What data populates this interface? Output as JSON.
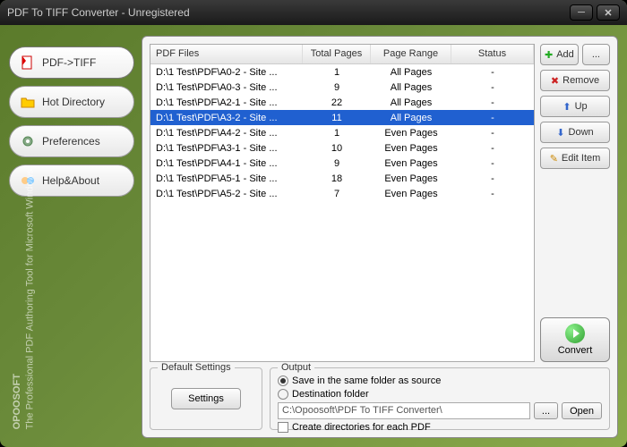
{
  "titlebar": {
    "title": "PDF To TIFF Converter - Unregistered"
  },
  "sidebar": {
    "items": [
      {
        "label": "PDF->TIFF"
      },
      {
        "label": "Hot Directory"
      },
      {
        "label": "Preferences"
      },
      {
        "label": "Help&About"
      }
    ]
  },
  "branding": {
    "name": "OPOOSOFT",
    "tagline": "The Professional PDF Authoring Tool for Microsoft Windows"
  },
  "table": {
    "headers": {
      "file": "PDF Files",
      "pages": "Total Pages",
      "range": "Page Range",
      "status": "Status"
    },
    "rows": [
      {
        "file": "D:\\1 Test\\PDF\\A0-2 - Site ...",
        "pages": "1",
        "range": "All Pages",
        "status": "-"
      },
      {
        "file": "D:\\1 Test\\PDF\\A0-3 - Site ...",
        "pages": "9",
        "range": "All Pages",
        "status": "-"
      },
      {
        "file": "D:\\1 Test\\PDF\\A2-1 - Site ...",
        "pages": "22",
        "range": "All Pages",
        "status": "-"
      },
      {
        "file": "D:\\1 Test\\PDF\\A3-2 - Site ...",
        "pages": "11",
        "range": "All Pages",
        "status": "-"
      },
      {
        "file": "D:\\1 Test\\PDF\\A4-2 - Site ...",
        "pages": "1",
        "range": "Even Pages",
        "status": "-"
      },
      {
        "file": "D:\\1 Test\\PDF\\A3-1 - Site ...",
        "pages": "10",
        "range": "Even Pages",
        "status": "-"
      },
      {
        "file": "D:\\1 Test\\PDF\\A4-1 - Site ...",
        "pages": "9",
        "range": "Even Pages",
        "status": "-"
      },
      {
        "file": "D:\\1 Test\\PDF\\A5-1 - Site ...",
        "pages": "18",
        "range": "Even Pages",
        "status": "-"
      },
      {
        "file": "D:\\1 Test\\PDF\\A5-2 - Site ...",
        "pages": "7",
        "range": "Even Pages",
        "status": "-"
      }
    ],
    "selectedIndex": 3
  },
  "buttons": {
    "add": "Add",
    "more": "...",
    "remove": "Remove",
    "up": "Up",
    "down": "Down",
    "edit": "Edit Item",
    "convert": "Convert"
  },
  "defaultSettings": {
    "title": "Default Settings",
    "button": "Settings"
  },
  "output": {
    "title": "Output",
    "sameFolder": "Save in the same folder as source",
    "destFolder": "Destination folder",
    "path": "C:\\Opoosoft\\PDF To TIFF Converter\\",
    "browse": "...",
    "open": "Open",
    "createDirs": "Create directories for each PDF"
  }
}
